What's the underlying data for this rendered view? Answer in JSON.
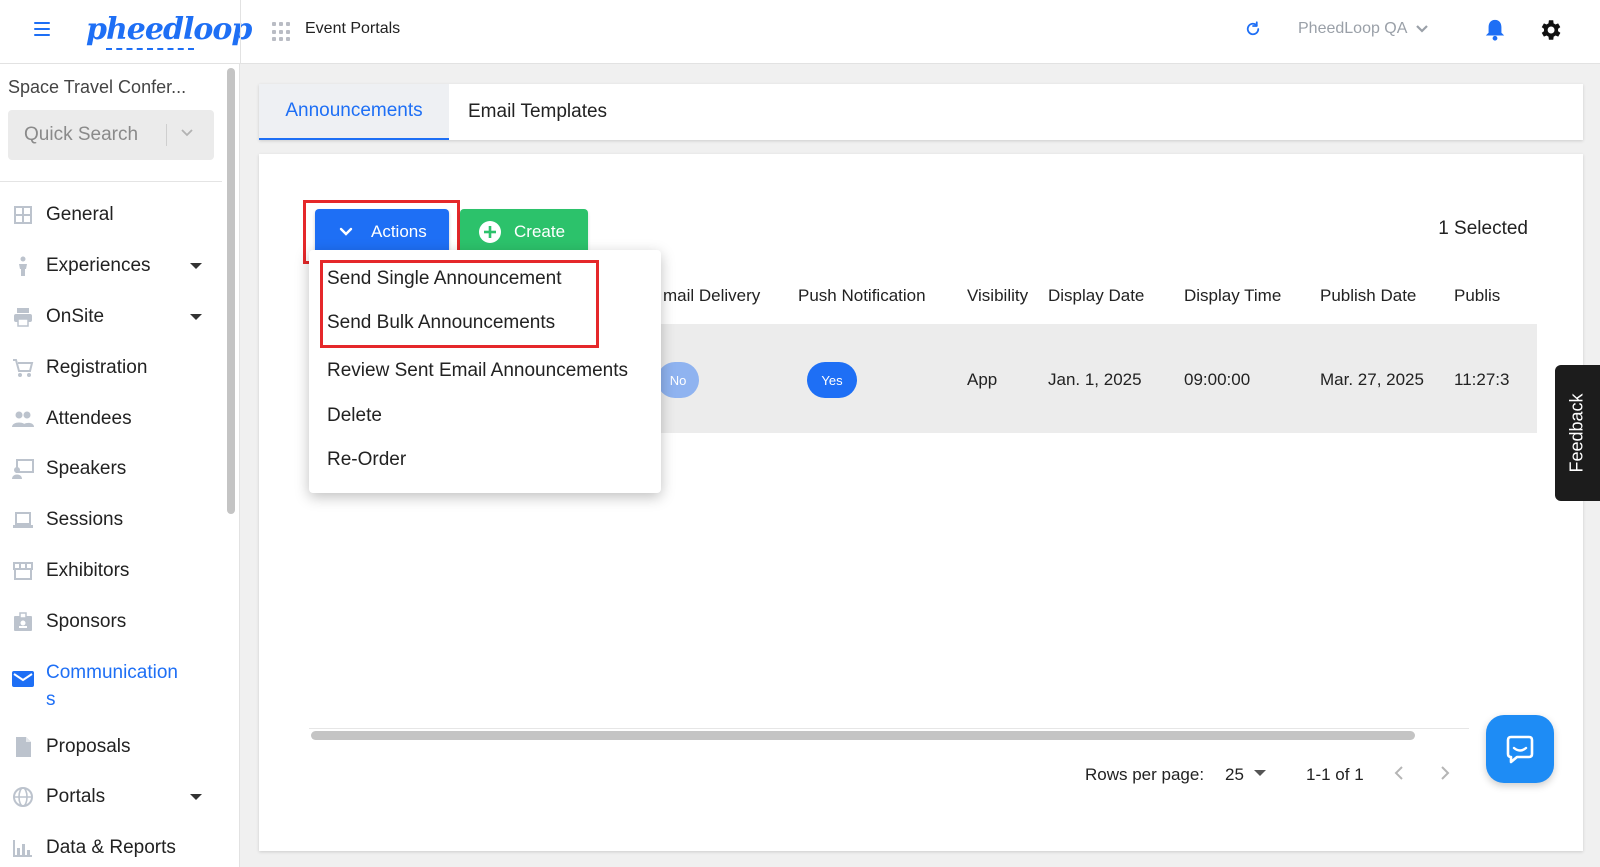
{
  "header": {
    "logo_text": "pheedloop",
    "section_title": "Event Portals",
    "org_name": "PheedLoop QA"
  },
  "sidebar": {
    "event_name": "Space Travel Confer...",
    "quick_search": "Quick Search",
    "items": [
      {
        "label": "General",
        "icon": "grid-icon",
        "has_caret": false
      },
      {
        "label": "Experiences",
        "icon": "person-icon",
        "has_caret": true
      },
      {
        "label": "OnSite",
        "icon": "printer-icon",
        "has_caret": true
      },
      {
        "label": "Registration",
        "icon": "cart-icon",
        "has_caret": false
      },
      {
        "label": "Attendees",
        "icon": "people-icon",
        "has_caret": false
      },
      {
        "label": "Speakers",
        "icon": "presenter-icon",
        "has_caret": false
      },
      {
        "label": "Sessions",
        "icon": "laptop-icon",
        "has_caret": false
      },
      {
        "label": "Exhibitors",
        "icon": "store-icon",
        "has_caret": false
      },
      {
        "label": "Sponsors",
        "icon": "badge-icon",
        "has_caret": false
      },
      {
        "label": "Communication\ns",
        "icon": "mail-icon",
        "has_caret": false,
        "active": true
      },
      {
        "label": "Proposals",
        "icon": "document-icon",
        "has_caret": false
      },
      {
        "label": "Portals",
        "icon": "globe-icon",
        "has_caret": true
      },
      {
        "label": "Data & Reports",
        "icon": "chart-icon",
        "has_caret": false
      }
    ]
  },
  "tabs": [
    {
      "label": "Announcements",
      "active": true
    },
    {
      "label": "Email Templates",
      "active": false
    }
  ],
  "toolbar": {
    "actions_label": "Actions",
    "create_label": "Create",
    "selected_label": "1 Selected"
  },
  "actions_menu": {
    "items": [
      "Send Single Announcement",
      "Send Bulk Announcements",
      "Review Sent Email Announcements",
      "Delete",
      "Re-Order"
    ]
  },
  "table": {
    "columns": [
      "mail Delivery",
      "Push Notification",
      "Visibility",
      "Display Date",
      "Display Time",
      "Publish Date",
      "Publis"
    ],
    "row": {
      "email_delivery": "No",
      "push_notification": "Yes",
      "visibility": "App",
      "display_date": "Jan. 1, 2025",
      "display_time": "09:00:00",
      "publish_date": "Mar. 27, 2025",
      "publish_time": "11:27:3"
    }
  },
  "pagination": {
    "rows_per_page_label": "Rows per page:",
    "rows_per_page_value": "25",
    "range": "1-1 of 1"
  },
  "feedback_label": "Feedback",
  "colors": {
    "primary": "#1e6ff5",
    "success": "#2cc26b",
    "highlight": "#e5282a"
  }
}
